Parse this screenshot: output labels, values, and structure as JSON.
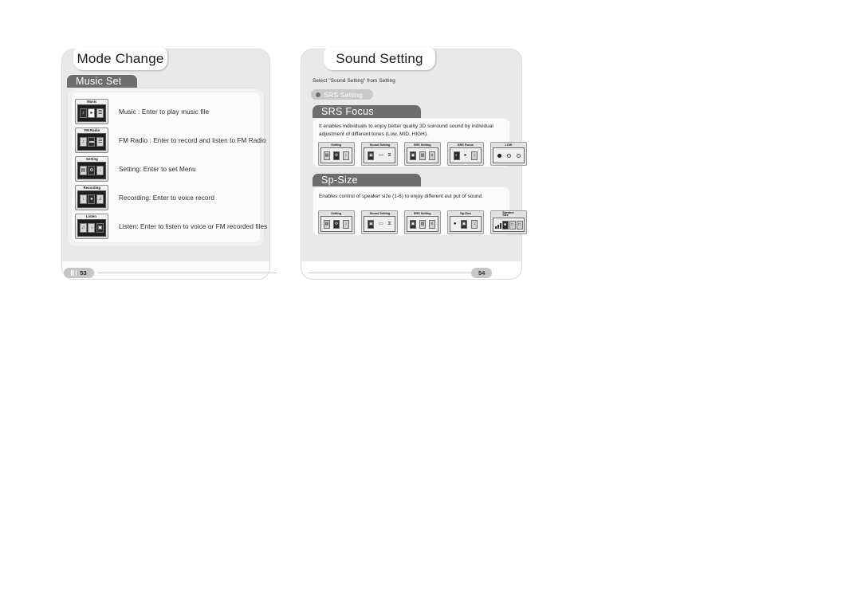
{
  "document": {
    "kind": "scanned-manual-spread",
    "background": "#ffffff"
  },
  "colors": {
    "page_bg": "#e9e9e9",
    "section_tab": "#6e6e6e",
    "pill": "#c9c9c9",
    "panel": "#f1f1f1",
    "text": "#2a2a2a"
  },
  "left_page": {
    "title": "Mode Change",
    "section": "Music Set",
    "page_number": "53",
    "rows": [
      {
        "icon_caption": "Music",
        "text": "Music : Enter to play music file",
        "lcd_glyphs": [
          "♪",
          "▸",
          "☰"
        ]
      },
      {
        "icon_caption": "FM Radio",
        "text": "FM Radio : Enter to record and listen to FM Radio",
        "lcd_glyphs": [
          "♪",
          "▬",
          "☰"
        ]
      },
      {
        "icon_caption": "Setting",
        "text": "Setting: Enter to set Menu",
        "lcd_glyphs": [
          "▤",
          "⚙",
          "↓"
        ]
      },
      {
        "icon_caption": "Recording",
        "text": "Recording: Enter to voice record",
        "lcd_glyphs": [
          "↓",
          "●",
          "♫"
        ]
      },
      {
        "icon_caption": "Listen",
        "text": "Listen: Enter to listen to voice or FM recorded files",
        "lcd_glyphs": [
          "♫",
          "↓",
          "▣"
        ]
      }
    ]
  },
  "right_page": {
    "title": "Sound Setting",
    "page_number": "54",
    "lead": "Select \"Sound Setting\" from Setting",
    "pill": "SRS Setting",
    "sections": [
      {
        "tab": "SRS Focus",
        "body": "It enables individuals to enjoy better quality 3D surround sound by individual adjustment of different tones (Low, MID, HIGH).",
        "icons": [
          {
            "caption": "Setting",
            "glyphs": [
              "▤",
              "⚙",
              "↓"
            ]
          },
          {
            "caption": "Sound Setting",
            "glyphs": [
              "▣",
              "▭",
              "⧖"
            ]
          },
          {
            "caption": "SRS Setting",
            "glyphs": [
              "▣",
              "▥",
              "≡"
            ]
          },
          {
            "caption": "SRS Focus",
            "glyphs": [
              "◐",
              "▸",
              "↓"
            ]
          },
          {
            "caption": "LOW",
            "glyphs": [
              "●",
              "○",
              "○"
            ]
          }
        ]
      },
      {
        "tab": "Sp-Size",
        "body": "Enables control of speaker size (1-6) to enjoy different out put of sound.",
        "icons": [
          {
            "caption": "Setting",
            "glyphs": [
              "▤",
              "⚙",
              "↓"
            ]
          },
          {
            "caption": "Sound Setting",
            "glyphs": [
              "▣",
              "▭",
              "⧖"
            ]
          },
          {
            "caption": "SRS Setting",
            "glyphs": [
              "▣",
              "▥",
              "≡"
            ]
          },
          {
            "caption": "Sp-Size",
            "glyphs": [
              "●",
              "▣",
              "↓"
            ]
          },
          {
            "caption": "Speaker\nSize",
            "glyphs": [
              "■",
              "□",
              "□"
            ]
          }
        ]
      }
    ]
  }
}
